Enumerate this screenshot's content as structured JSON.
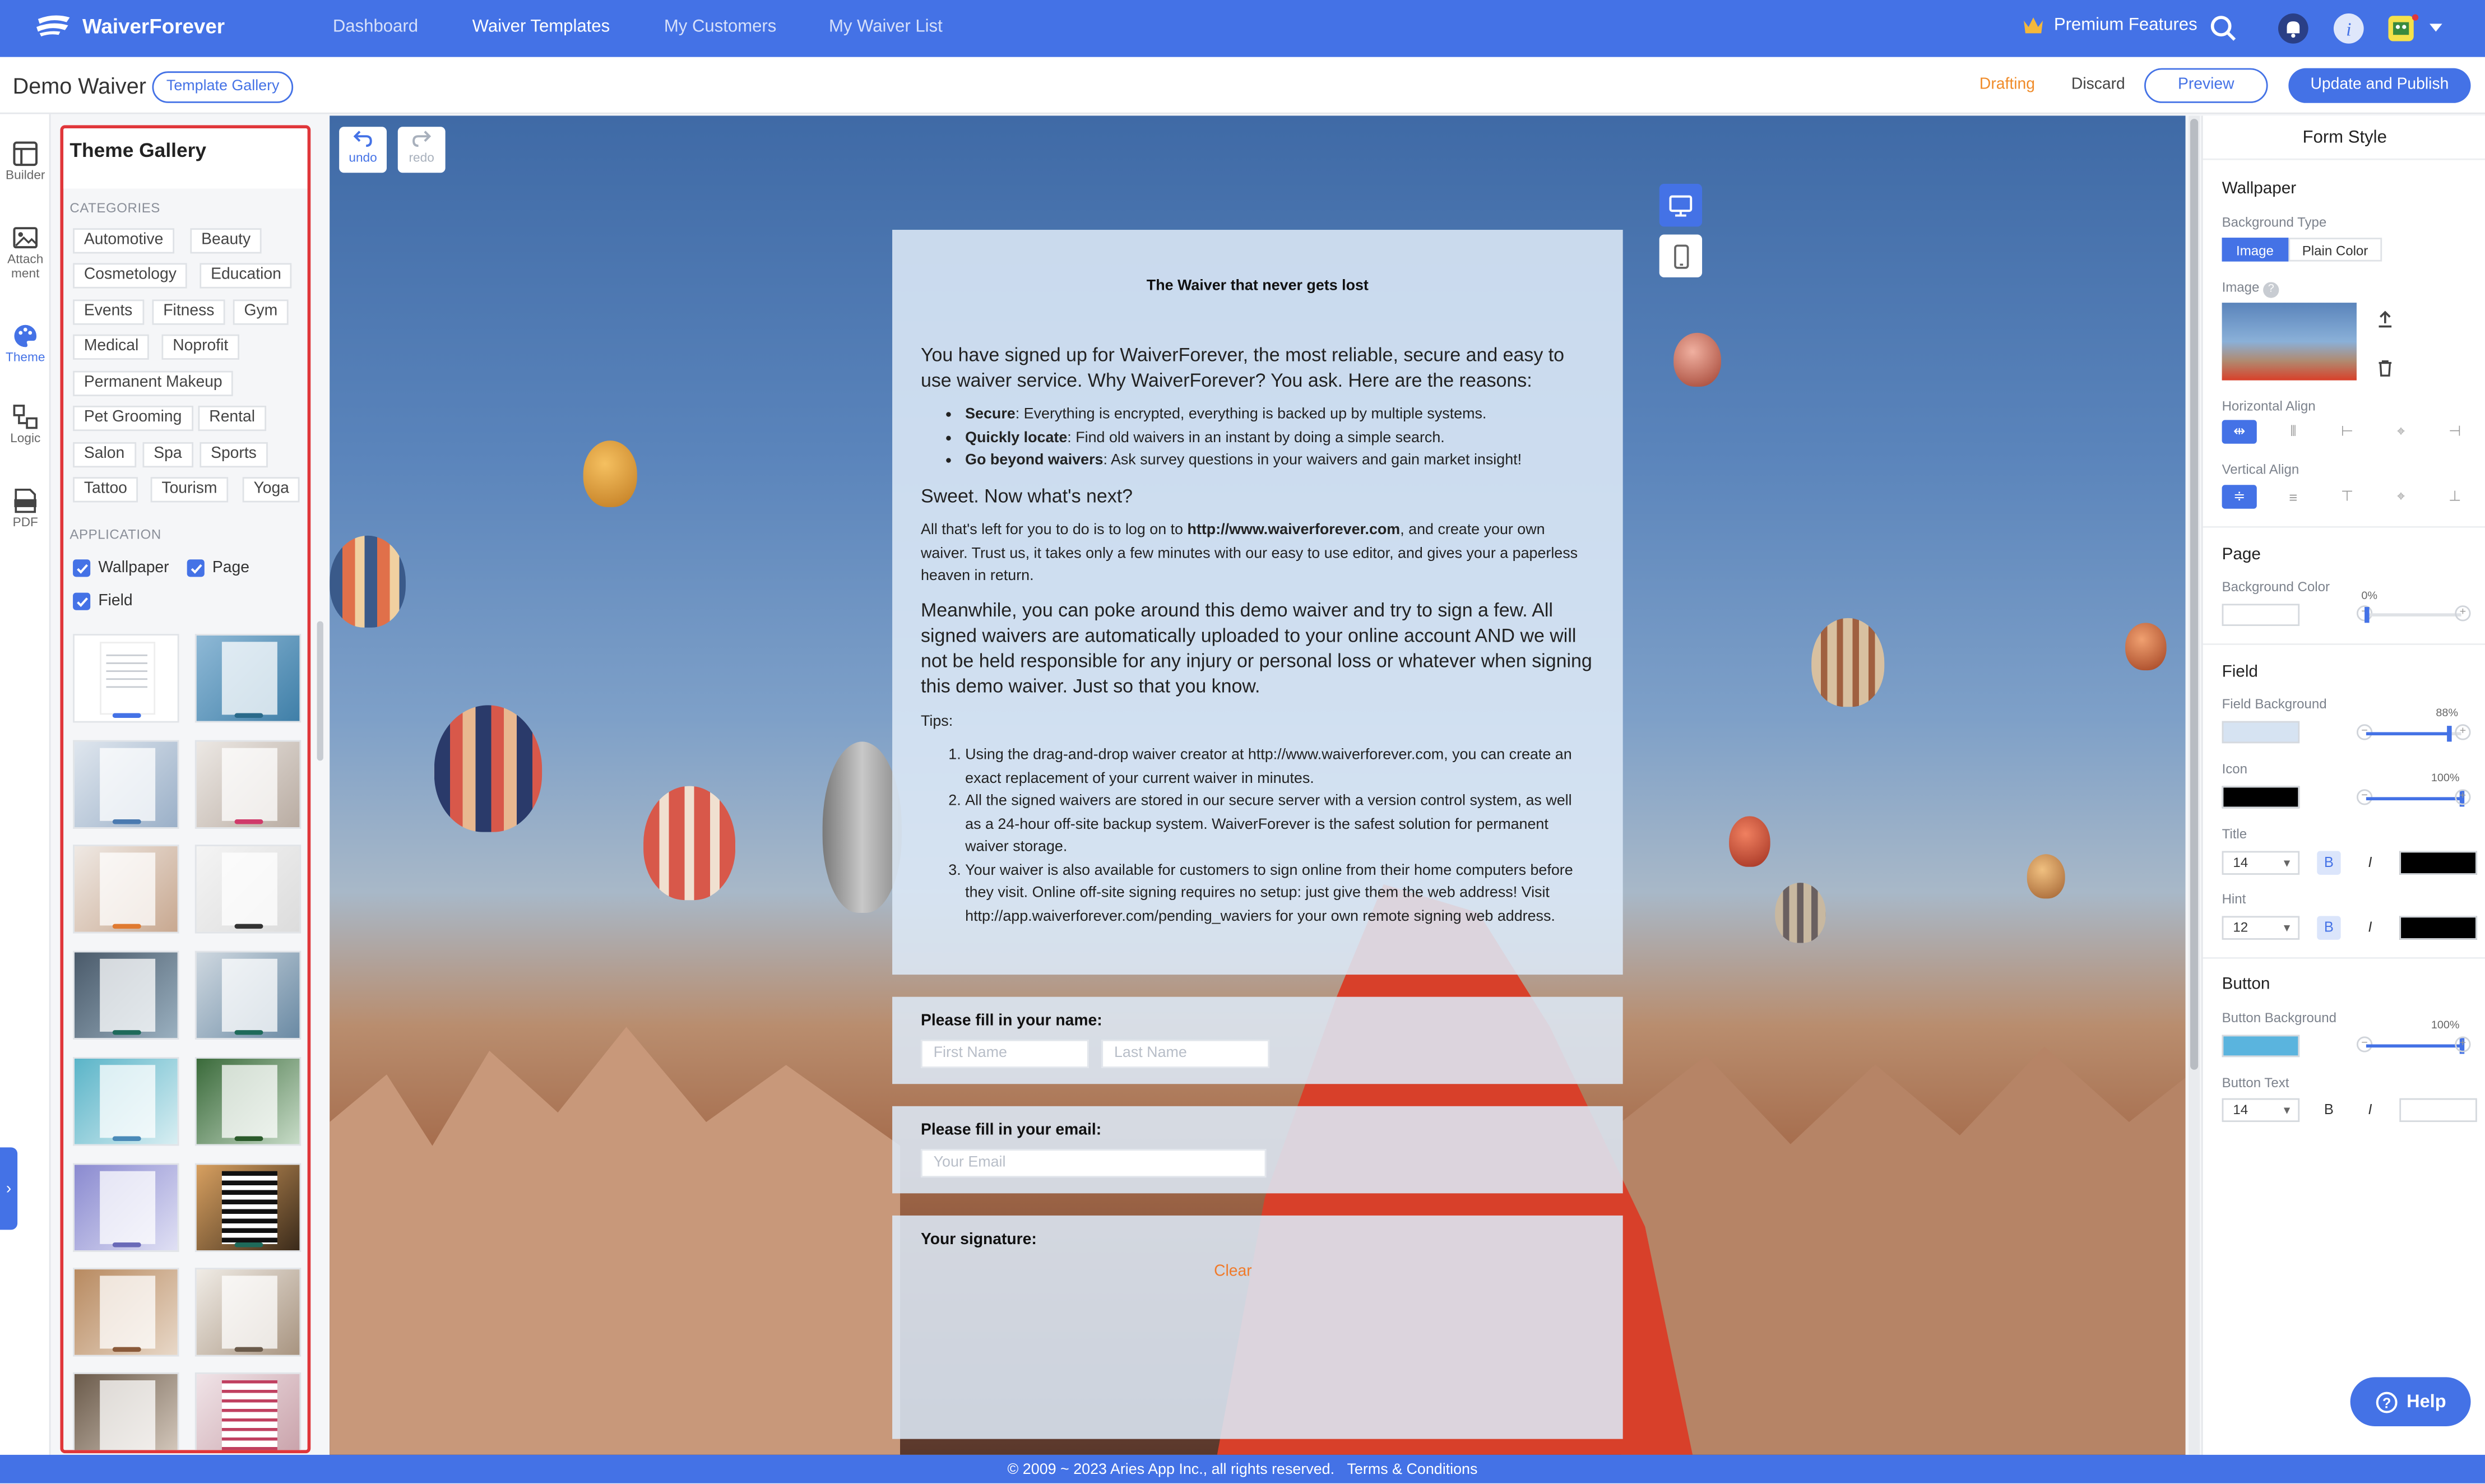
{
  "app": {
    "name": "WaiverForever"
  },
  "nav": {
    "items": [
      "Dashboard",
      "Waiver Templates",
      "My Customers",
      "My Waiver List"
    ],
    "premium": "Premium Features"
  },
  "subheader": {
    "title": "Demo Waiver",
    "template_gallery": "Template Gallery",
    "status": "Drafting",
    "discard": "Discard",
    "preview": "Preview",
    "publish": "Update and Publish"
  },
  "rail": {
    "builder": "Builder",
    "attachment": "Attach ment",
    "theme": "Theme",
    "logic": "Logic",
    "pdf": "PDF"
  },
  "gallery": {
    "title": "Theme Gallery",
    "categories_label": "CATEGORIES",
    "categories": [
      "Automotive",
      "Beauty",
      "Cosmetology",
      "Education",
      "Events",
      "Fitness",
      "Gym",
      "Medical",
      "Noprofit",
      "Permanent Makeup",
      "Pet Grooming",
      "Rental",
      "Salon",
      "Spa",
      "Sports",
      "Tattoo",
      "Tourism",
      "Yoga"
    ],
    "application_label": "APPLICATION",
    "application": [
      "Wallpaper",
      "Page",
      "Field"
    ]
  },
  "toolbar": {
    "undo": "undo",
    "redo": "redo"
  },
  "document": {
    "title": "The Waiver that never gets lost",
    "intro": "You have signed up for WaiverForever, the most reliable, secure and easy to use waiver service. Why WaiverForever? You ask. Here are the reasons:",
    "bullets": [
      {
        "bold": "Secure",
        "text": ": Everything is encrypted, everything is backed up by multiple systems."
      },
      {
        "bold": "Quickly locate",
        "text": ": Find old waivers in an instant by doing a simple search."
      },
      {
        "bold": "Go beyond waivers",
        "text": ": Ask survey questions in your waivers and gain market insight!"
      }
    ],
    "next": "Sweet. Now what's next?",
    "p2a": "All that's left for you to do is to log on to ",
    "p2link": "http://www.waiverforever.com",
    "p2b": ", and create your own waiver. Trust us, it takes only a few minutes with our easy to use editor, and gives your a paperless heaven in return.",
    "p3": "Meanwhile, you can poke around this demo waiver and try to sign a few. All signed waivers are automatically uploaded to your online account AND we will not be held responsible for any injury or personal loss or whatever when signing this demo waiver. Just so that you know.",
    "tips": "Tips:",
    "tip_items": [
      "Using the drag-and-drop waiver creator at http://www.waiverforever.com, you can create an exact replacement of your current waiver in minutes.",
      "All the signed waivers are stored in our secure server with a version control system, as well as a 24-hour off-site backup system. WaiverForever is the safest solution for permanent waiver storage.",
      "Your waiver is also available for customers to sign online from their home computers before they visit. Online off-site signing requires no setup: just give them the web address! Visit http://app.waiverforever.com/pending_waviers for your own remote signing web address."
    ]
  },
  "fields": {
    "name_title": "Please fill in your name:",
    "first_placeholder": "First Name",
    "last_placeholder": "Last Name",
    "email_title": "Please fill in your email:",
    "email_placeholder": "Your Email",
    "signature_title": "Your signature:",
    "clear": "Clear"
  },
  "form_style": {
    "title": "Form Style",
    "wallpaper": {
      "section": "Wallpaper",
      "bg_type_label": "Background Type",
      "bg_types": [
        "Image",
        "Plain Color"
      ],
      "image_label": "Image",
      "h_align_label": "Horizontal Align",
      "v_align_label": "Vertical Align"
    },
    "page": {
      "section": "Page",
      "bg_color_label": "Background Color",
      "opacity": 0,
      "opacity_label": "0%",
      "color": "#ffffff"
    },
    "field": {
      "section": "Field",
      "bg_label": "Field Background",
      "bg_opacity": 88,
      "bg_opacity_label": "88%",
      "bg_color": "#d6e3f2",
      "icon_label": "Icon",
      "icon_opacity": 100,
      "icon_opacity_label": "100%",
      "icon_color": "#000000",
      "title_label": "Title",
      "title_size": "14",
      "title_color": "#000000",
      "hint_label": "Hint",
      "hint_size": "12",
      "hint_color": "#000000"
    },
    "button": {
      "section": "Button",
      "bg_label": "Button Background",
      "bg_opacity": 100,
      "bg_opacity_label": "100%",
      "bg_color": "#5ab4de",
      "text_label": "Button Text",
      "text_size": "14",
      "text_color": "#ffffff"
    },
    "bold": "B",
    "italic": "I"
  },
  "help": "Help",
  "footer": {
    "copyright": "© 2009 ~ 2023 Aries App Inc., all rights reserved.",
    "terms": "Terms & Conditions"
  }
}
